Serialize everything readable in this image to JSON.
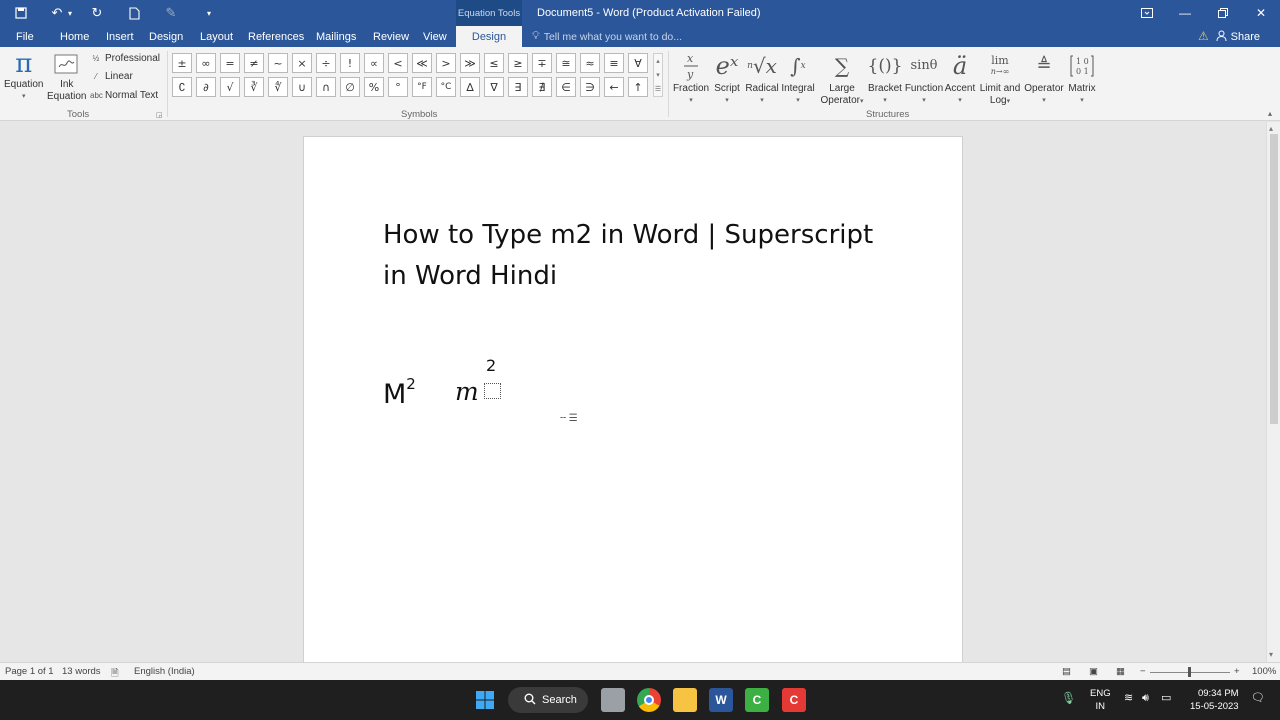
{
  "titlebar": {
    "context_label": "Equation Tools",
    "doc_title": "Document5 - Word (Product Activation Failed)"
  },
  "tabs": [
    {
      "label": "File"
    },
    {
      "label": "Home"
    },
    {
      "label": "Insert"
    },
    {
      "label": "Design"
    },
    {
      "label": "Layout"
    },
    {
      "label": "References"
    },
    {
      "label": "Mailings"
    },
    {
      "label": "Review"
    },
    {
      "label": "View"
    },
    {
      "label": "Design",
      "active": true
    }
  ],
  "tell_me": "Tell me what you want to do...",
  "share": "Share",
  "tools": {
    "equation": "Equation",
    "ink_line1": "Ink",
    "ink_line2": "Equation",
    "professional": "Professional",
    "linear": "Linear",
    "normal_text": "Normal Text",
    "group_label": "Tools"
  },
  "symbols": {
    "row1": [
      "±",
      "∞",
      "=",
      "≠",
      "~",
      "×",
      "÷",
      "!",
      "∝",
      "<",
      "≪",
      ">",
      "≫",
      "≤",
      "≥",
      "∓",
      "≅",
      "≈",
      "≡",
      "∀"
    ],
    "row2": [
      "∁",
      "∂",
      "√",
      "∛",
      "∜",
      "∪",
      "∩",
      "∅",
      "%",
      "°",
      "°F",
      "°C",
      "∆",
      "∇",
      "∃",
      "∄",
      "∈",
      "∋",
      "←",
      "↑"
    ],
    "group_label": "Symbols"
  },
  "structures": {
    "items": [
      {
        "label": "Fraction"
      },
      {
        "label": "Script"
      },
      {
        "label": "Radical"
      },
      {
        "label": "Integral"
      },
      {
        "label_line1": "Large",
        "label_line2": "Operator"
      },
      {
        "label": "Bracket"
      },
      {
        "label": "Function"
      },
      {
        "label": "Accent"
      },
      {
        "label_line1": "Limit and",
        "label_line2": "Log"
      },
      {
        "label": "Operator"
      },
      {
        "label": "Matrix"
      }
    ],
    "function_icon": "sinθ",
    "limit_icon_top": "lim",
    "limit_icon_bottom": "n→∞",
    "group_label": "Structures"
  },
  "document": {
    "heading": "How to Type m2 in Word | Superscript in Word Hindi",
    "text_base": "M",
    "text_sup": "2",
    "eq_base": "m",
    "eq_sup": "2"
  },
  "status": {
    "page": "Page 1 of 1",
    "words": "13 words",
    "language": "English (India)",
    "zoom": "100%",
    "zoom_minus": "−",
    "zoom_plus": "+"
  },
  "taskbar": {
    "search": "Search",
    "lang_line1": "ENG",
    "lang_line2": "IN",
    "time": "09:34 PM",
    "date": "15-05-2023"
  }
}
